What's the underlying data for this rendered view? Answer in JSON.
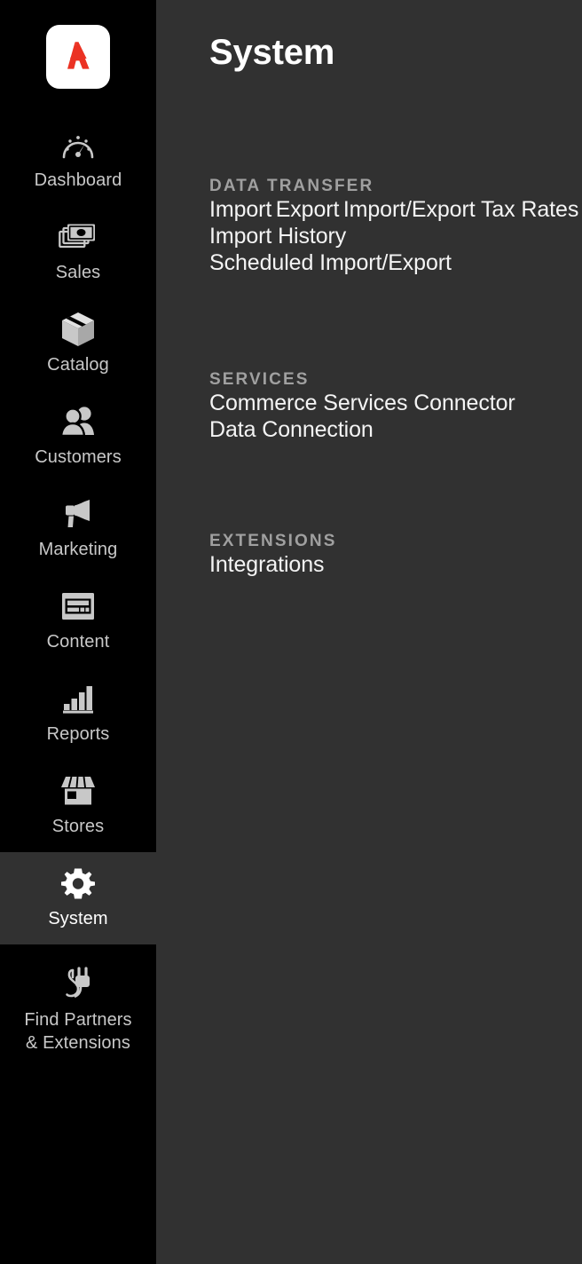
{
  "sidebar": {
    "logo": {
      "name": "adobe-logo",
      "tile_color": "#ffffff",
      "mark_color": "#eb3223"
    },
    "items": [
      {
        "label": "Dashboard",
        "icon": "gauge-icon",
        "active": false
      },
      {
        "label": "Sales",
        "icon": "money-icon",
        "active": false
      },
      {
        "label": "Catalog",
        "icon": "box-icon",
        "active": false
      },
      {
        "label": "Customers",
        "icon": "people-icon",
        "active": false
      },
      {
        "label": "Marketing",
        "icon": "megaphone-icon",
        "active": false
      },
      {
        "label": "Content",
        "icon": "page-layout-icon",
        "active": false
      },
      {
        "label": "Reports",
        "icon": "bar-chart-icon",
        "active": false
      },
      {
        "label": "Stores",
        "icon": "storefront-icon",
        "active": false
      },
      {
        "label": "System",
        "icon": "gear-icon",
        "active": true
      },
      {
        "label": "Find Partners\n& Extensions",
        "icon": "plug-icon",
        "active": false
      }
    ]
  },
  "main": {
    "title": "System",
    "sections": [
      {
        "heading": "DATA TRANSFER",
        "items": [
          "Import",
          "Export",
          "Import/Export Tax Rates",
          "Import History",
          "Scheduled Import/Export"
        ]
      },
      {
        "heading": "SERVICES",
        "items": [
          "Commerce Services Connector",
          "Data Connection"
        ]
      },
      {
        "heading": "EXTENSIONS",
        "items": [
          "Integrations"
        ]
      }
    ]
  },
  "colors": {
    "sidebar_bg": "#000000",
    "panel_bg": "#313131",
    "active_bg": "#313131",
    "icon": "#c8c8c8",
    "icon_active": "#ffffff",
    "heading": "#a0a0a0",
    "link": "#f4f4f4",
    "brand_red": "#eb3223"
  }
}
